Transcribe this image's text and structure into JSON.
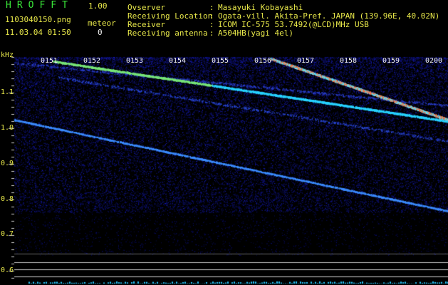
{
  "header": {
    "app_name": "HROFFT",
    "app_version": "1.00",
    "filename": "1103040150.png",
    "datetime": "11.03.04 01:50",
    "meteor_label": "meteor",
    "meteor_count": "0",
    "info": [
      {
        "label": "Ovserver",
        "value": "Masayuki Kobayashi"
      },
      {
        "label": "Receiving Location",
        "value": "Ogata-vill. Akita-Pref. JAPAN (139.96E, 40.02N)"
      },
      {
        "label": "Receiver",
        "value": "ICOM IC-575 53.7492(@LCD)MHz USB"
      },
      {
        "label": "Receiving antenna",
        "value": "A504HB(yagi 4el)"
      }
    ]
  },
  "spectrogram": {
    "unit_label": "kHz",
    "freq_ticks": [
      "1.1",
      "1.0",
      "0.9",
      "0.8",
      "0.7",
      "0.6"
    ],
    "time_ticks": [
      "0151",
      "0152",
      "0153",
      "0154",
      "0155",
      "0156",
      "0157",
      "0158",
      "0159",
      "0200"
    ],
    "colors": {
      "background": "#000000",
      "noise": "#1a1aa0",
      "signal": "#1ec8ff",
      "strong": "#ff5a28",
      "accent": "#e8e84a"
    }
  }
}
